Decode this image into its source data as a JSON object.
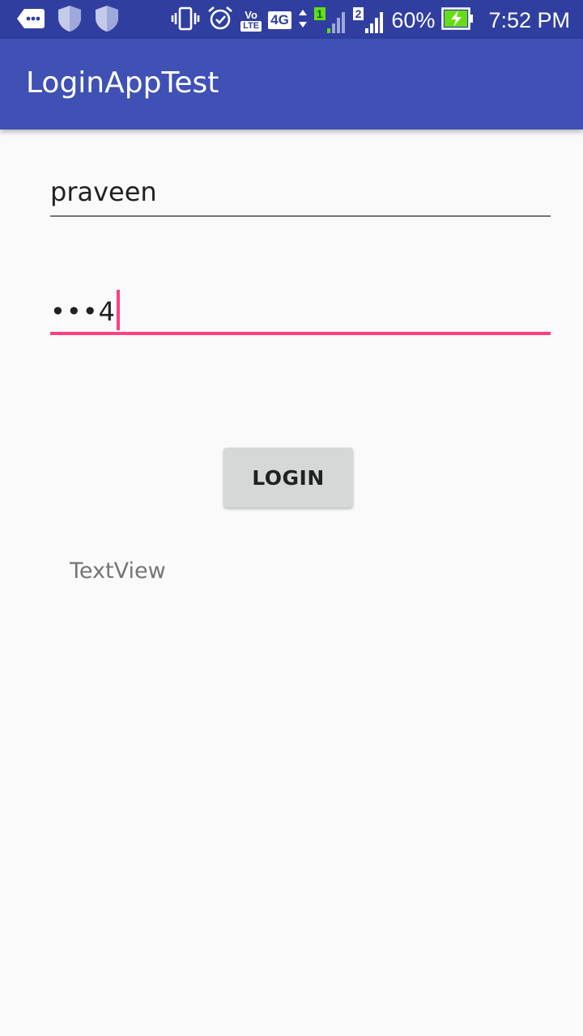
{
  "status_bar": {
    "notification_icons": [
      "message-icon",
      "shield-icon",
      "shield-icon"
    ],
    "vibrate_icon": "vibrate-icon",
    "alarm_icon": "alarm-icon",
    "volte_top": "Vo",
    "volte_bottom": "LTE",
    "network_type": "4G",
    "sim1_label": "1",
    "sim2_label": "2",
    "battery_percent": "60%",
    "battery_level": 0.6,
    "time": "7:52 PM",
    "colors": {
      "background": "#303f9f",
      "battery_fill": "#64dd17"
    }
  },
  "app_bar": {
    "title": "LoginAppTest",
    "color": "#3f51b5"
  },
  "form": {
    "username_value": "praveen",
    "password_masked": "•••4",
    "login_button_label": "LOGIN",
    "result_text": "TextView",
    "accent_color": "#ff4081"
  }
}
